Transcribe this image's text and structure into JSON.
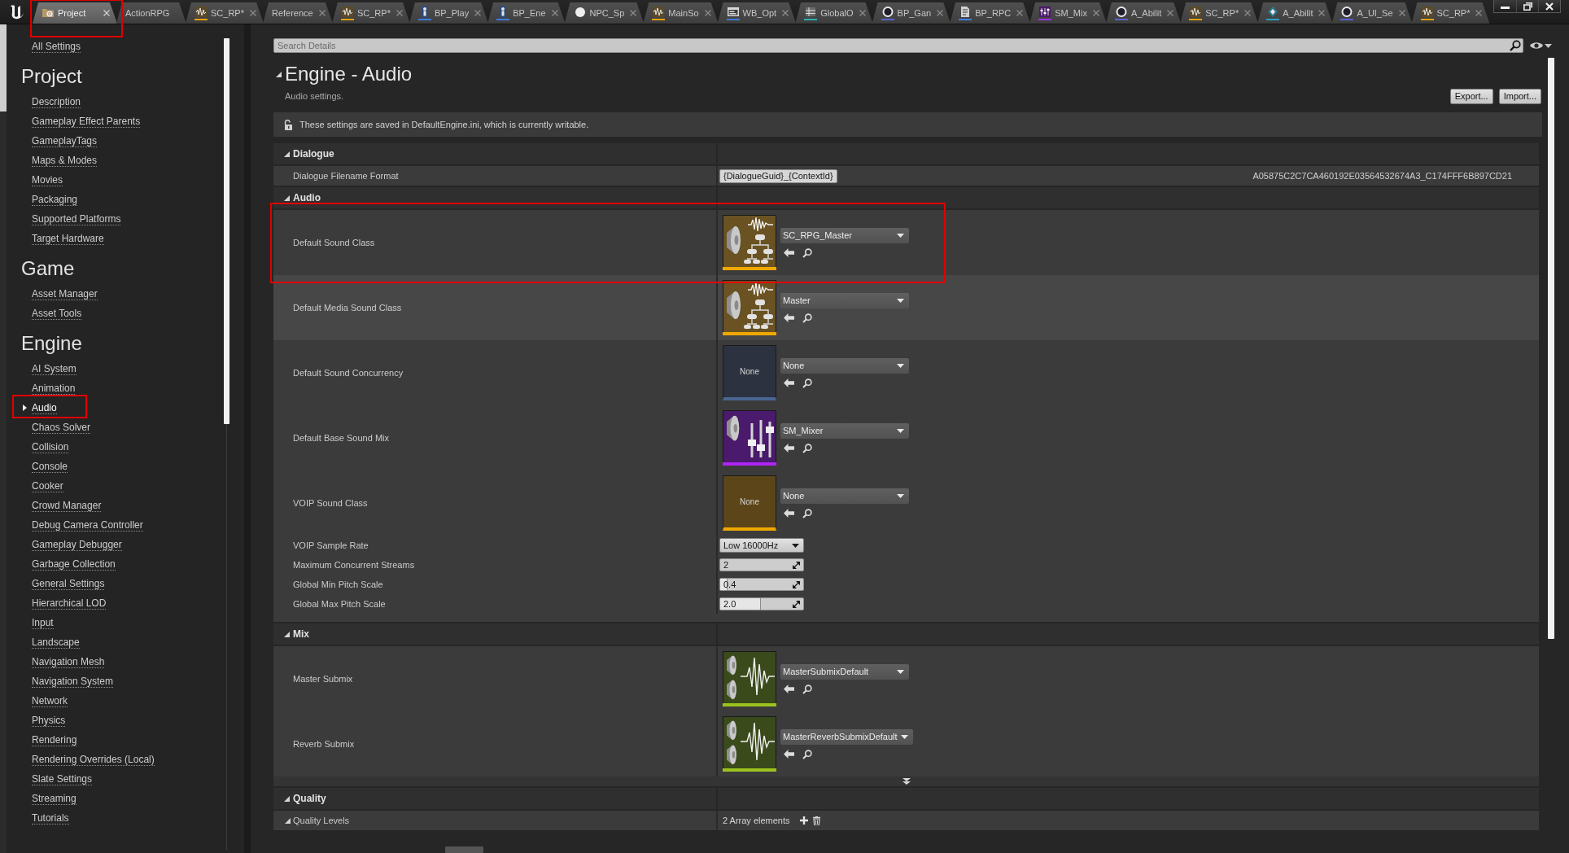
{
  "tabs": [
    {
      "label": "Project",
      "kind": "settings",
      "selected": true,
      "closable": true,
      "highlighted": true
    },
    {
      "label": "ActionRPG",
      "kind": "plain",
      "selected": false,
      "closable": false,
      "highlighted": false
    },
    {
      "label": "SC_RP*",
      "kind": "sound-class",
      "selected": false,
      "closable": true,
      "highlighted": false
    },
    {
      "label": "Reference",
      "kind": "plain",
      "selected": false,
      "closable": true,
      "highlighted": false
    },
    {
      "label": "SC_RP*",
      "kind": "sound-class",
      "selected": false,
      "closable": true,
      "highlighted": false
    },
    {
      "label": "BP_Play",
      "kind": "blueprint",
      "selected": false,
      "closable": true,
      "highlighted": false
    },
    {
      "label": "BP_Ene",
      "kind": "blueprint",
      "selected": false,
      "closable": true,
      "highlighted": false
    },
    {
      "label": "NPC_Sp",
      "kind": "material",
      "selected": false,
      "closable": true,
      "highlighted": false
    },
    {
      "label": "MainSo",
      "kind": "sound-class",
      "selected": false,
      "closable": true,
      "highlighted": false
    },
    {
      "label": "WB_Opt",
      "kind": "widget",
      "selected": false,
      "closable": true,
      "highlighted": false
    },
    {
      "label": "GlobalO",
      "kind": "data",
      "selected": false,
      "closable": true,
      "highlighted": false
    },
    {
      "label": "BP_Gan",
      "kind": "ring",
      "selected": false,
      "closable": true,
      "highlighted": false
    },
    {
      "label": "BP_RPC",
      "kind": "script",
      "selected": false,
      "closable": true,
      "highlighted": false
    },
    {
      "label": "SM_Mix",
      "kind": "sound-mix",
      "selected": false,
      "closable": true,
      "highlighted": false
    },
    {
      "label": "A_Abilit",
      "kind": "ring",
      "selected": false,
      "closable": true,
      "highlighted": false
    },
    {
      "label": "SC_RP*",
      "kind": "sound-class",
      "selected": false,
      "closable": true,
      "highlighted": false
    },
    {
      "label": "A_Abilit",
      "kind": "ability",
      "selected": false,
      "closable": true,
      "highlighted": false
    },
    {
      "label": "A_UI_Se",
      "kind": "ring",
      "selected": false,
      "closable": true,
      "highlighted": false
    },
    {
      "label": "SC_RP*",
      "kind": "sound-class",
      "selected": false,
      "closable": true,
      "highlighted": false
    }
  ],
  "sidebar": {
    "top_link": "All Settings",
    "sections": [
      {
        "heading": "Project",
        "items": [
          {
            "label": "Description",
            "selected": false,
            "highlighted": false
          },
          {
            "label": "Gameplay Effect Parents",
            "selected": false,
            "highlighted": false
          },
          {
            "label": "GameplayTags",
            "selected": false,
            "highlighted": false
          },
          {
            "label": "Maps & Modes",
            "selected": false,
            "highlighted": false
          },
          {
            "label": "Movies",
            "selected": false,
            "highlighted": false
          },
          {
            "label": "Packaging",
            "selected": false,
            "highlighted": false
          },
          {
            "label": "Supported Platforms",
            "selected": false,
            "highlighted": false
          },
          {
            "label": "Target Hardware",
            "selected": false,
            "highlighted": false
          }
        ]
      },
      {
        "heading": "Game",
        "items": [
          {
            "label": "Asset Manager",
            "selected": false,
            "highlighted": false
          },
          {
            "label": "Asset Tools",
            "selected": false,
            "highlighted": false
          }
        ]
      },
      {
        "heading": "Engine",
        "items": [
          {
            "label": "AI System",
            "selected": false,
            "highlighted": false
          },
          {
            "label": "Animation",
            "selected": false,
            "highlighted": false
          },
          {
            "label": "Audio",
            "selected": true,
            "highlighted": true
          },
          {
            "label": "Chaos Solver",
            "selected": false,
            "highlighted": false
          },
          {
            "label": "Collision",
            "selected": false,
            "highlighted": false
          },
          {
            "label": "Console",
            "selected": false,
            "highlighted": false
          },
          {
            "label": "Cooker",
            "selected": false,
            "highlighted": false
          },
          {
            "label": "Crowd Manager",
            "selected": false,
            "highlighted": false
          },
          {
            "label": "Debug Camera Controller",
            "selected": false,
            "highlighted": false
          },
          {
            "label": "Gameplay Debugger",
            "selected": false,
            "highlighted": false
          },
          {
            "label": "Garbage Collection",
            "selected": false,
            "highlighted": false
          },
          {
            "label": "General Settings",
            "selected": false,
            "highlighted": false
          },
          {
            "label": "Hierarchical LOD",
            "selected": false,
            "highlighted": false
          },
          {
            "label": "Input",
            "selected": false,
            "highlighted": false
          },
          {
            "label": "Landscape",
            "selected": false,
            "highlighted": false
          },
          {
            "label": "Navigation Mesh",
            "selected": false,
            "highlighted": false
          },
          {
            "label": "Navigation System",
            "selected": false,
            "highlighted": false
          },
          {
            "label": "Network",
            "selected": false,
            "highlighted": false
          },
          {
            "label": "Physics",
            "selected": false,
            "highlighted": false
          },
          {
            "label": "Rendering",
            "selected": false,
            "highlighted": false
          },
          {
            "label": "Rendering Overrides (Local)",
            "selected": false,
            "highlighted": false
          },
          {
            "label": "Slate Settings",
            "selected": false,
            "highlighted": false
          },
          {
            "label": "Streaming",
            "selected": false,
            "highlighted": false
          },
          {
            "label": "Tutorials",
            "selected": false,
            "highlighted": false
          }
        ]
      }
    ]
  },
  "search": {
    "placeholder": "Search Details"
  },
  "page": {
    "title": "Engine - Audio",
    "expanded": true,
    "subtitle": "Audio settings.",
    "buttons": [
      "Export...",
      "Import..."
    ],
    "notice": "These settings are saved in DefaultEngine.ini, which is currently writable."
  },
  "categories": [
    {
      "title": "Dialogue",
      "expanded": true,
      "advanced_toggle": false,
      "properties": [
        {
          "kind": "text",
          "label": "Dialogue Filename Format",
          "value": "{DialogueGuid}_{ContextId}",
          "preview": "A05875C2C7CA460192E03564532674A3_C174FFF6B897CD21",
          "hovered": false,
          "highlighted": false
        }
      ]
    },
    {
      "title": "Audio",
      "expanded": true,
      "advanced_toggle": false,
      "properties": [
        {
          "kind": "asset",
          "label": "Default Sound Class",
          "thumbnail": {
            "kind": "sound-class"
          },
          "value": "SC_RPG_Master",
          "hovered": false,
          "highlighted": true
        },
        {
          "kind": "asset",
          "label": "Default Media Sound Class",
          "thumbnail": {
            "kind": "sound-class"
          },
          "value": "Master",
          "hovered": true,
          "highlighted": false
        },
        {
          "kind": "asset",
          "label": "Default Sound Concurrency",
          "thumbnail": {
            "kind": "sound-concurrency",
            "text": "None"
          },
          "value": "None",
          "hovered": false,
          "highlighted": false
        },
        {
          "kind": "asset",
          "label": "Default Base Sound Mix",
          "thumbnail": {
            "kind": "sound-mix"
          },
          "value": "SM_Mixer",
          "hovered": false,
          "highlighted": false
        },
        {
          "kind": "asset",
          "label": "VOIP Sound Class",
          "thumbnail": {
            "kind": "sound-class",
            "text": "None"
          },
          "value": "None",
          "hovered": false,
          "highlighted": false
        },
        {
          "kind": "enum",
          "label": "VOIP Sample Rate",
          "value": "Low 16000Hz",
          "hovered": false,
          "highlighted": false
        },
        {
          "kind": "number",
          "label": "Maximum Concurrent Streams",
          "value": "2",
          "hovered": false,
          "highlighted": false
        },
        {
          "kind": "number",
          "label": "Global Min Pitch Scale",
          "value": "0.4",
          "level": 0.09,
          "hovered": false,
          "highlighted": false
        },
        {
          "kind": "number",
          "label": "Global Max Pitch Scale",
          "value": "2.0",
          "level": 0.49,
          "hovered": false,
          "highlighted": false
        }
      ]
    },
    {
      "title": "Mix",
      "expanded": true,
      "advanced_toggle": true,
      "properties": [
        {
          "kind": "asset",
          "label": "Master Submix",
          "thumbnail": {
            "kind": "sound-submix"
          },
          "value": "MasterSubmixDefault",
          "hovered": false,
          "highlighted": false
        },
        {
          "kind": "asset",
          "label": "Reverb Submix",
          "thumbnail": {
            "kind": "sound-submix"
          },
          "value": "MasterReverbSubmixDefault",
          "hovered": false,
          "highlighted": false
        }
      ]
    },
    {
      "title": "Quality",
      "expanded": true,
      "advanced_toggle": false,
      "properties": [
        {
          "kind": "array",
          "label": "Quality Levels",
          "expanded": true,
          "value": "2 Array elements",
          "hovered": false,
          "highlighted": false
        }
      ]
    }
  ]
}
